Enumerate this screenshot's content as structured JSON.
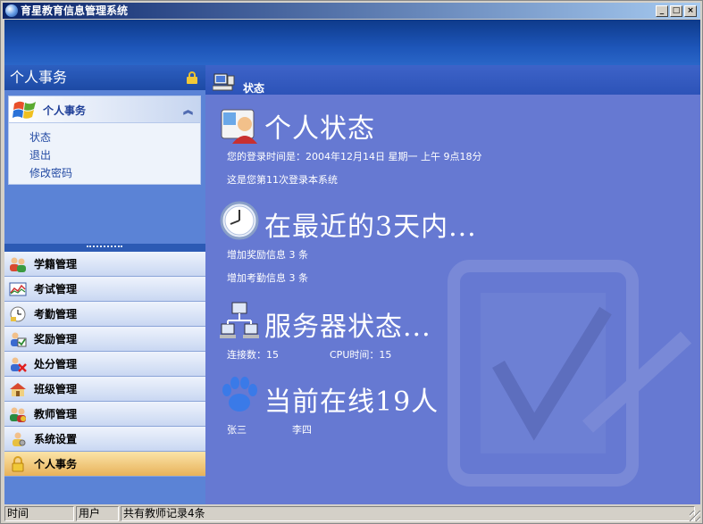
{
  "window": {
    "title": "育星教育信息管理系统",
    "controls": [
      "_",
      "□",
      "×"
    ]
  },
  "left": {
    "header": "个人事务",
    "card": {
      "title": "个人事务",
      "links": [
        "状态",
        "退出",
        "修改密码"
      ]
    },
    "nav": [
      {
        "label": "学籍管理",
        "icon": "students-icon"
      },
      {
        "label": "考试管理",
        "icon": "chart-icon"
      },
      {
        "label": "考勤管理",
        "icon": "clock-icon"
      },
      {
        "label": "奖励管理",
        "icon": "award-icon"
      },
      {
        "label": "处分管理",
        "icon": "penalty-icon"
      },
      {
        "label": "班级管理",
        "icon": "home-icon"
      },
      {
        "label": "教师管理",
        "icon": "teachers-icon"
      },
      {
        "label": "系统设置",
        "icon": "settings-icon"
      },
      {
        "label": "个人事务",
        "icon": "lock-icon",
        "active": true
      }
    ]
  },
  "main": {
    "header": "状态",
    "personal": {
      "title": "个人状态",
      "login_time": "您的登录时间是：2004年12月14日 星期一 上午 9点18分",
      "login_count": "这是您第11次登录本系统"
    },
    "recent": {
      "title": "在最近的3天内...",
      "lines": [
        "增加奖励信息 3 条",
        "增加考勤信息 3 条"
      ]
    },
    "server": {
      "title": "服务器状态...",
      "connections": "连接数：15",
      "cpu": "CPU时间：15"
    },
    "online": {
      "title": "当前在线19人",
      "users": [
        "张三",
        "李四"
      ]
    }
  },
  "statusbar": {
    "cells": [
      "时间",
      "用户",
      "共有教师记录4条"
    ]
  },
  "colors": {
    "main_bg": "#6679d2",
    "active_nav": "#e8b25a",
    "banner": "#1d55b8"
  }
}
